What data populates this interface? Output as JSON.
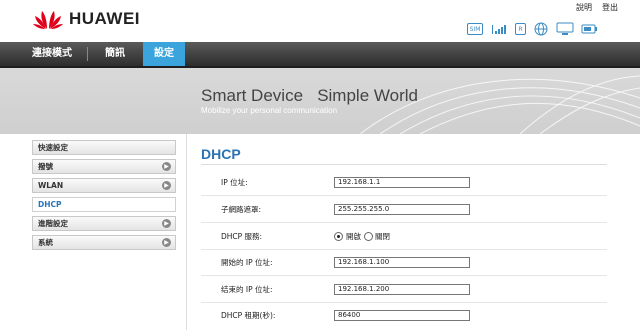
{
  "brand": {
    "name": "HUAWEI",
    "logo_icon": "huawei-petal-logo",
    "logo_color": "#e1001a"
  },
  "top_links": {
    "help": "說明",
    "logout": "登出"
  },
  "status_icons": [
    {
      "name": "sim-icon",
      "text": "SIM"
    },
    {
      "name": "signal-icon",
      "text": ""
    },
    {
      "name": "roaming-icon",
      "text": "R"
    },
    {
      "name": "globe-icon",
      "text": ""
    },
    {
      "name": "monitor-icon",
      "text": ""
    },
    {
      "name": "battery-icon",
      "text": ""
    }
  ],
  "nav": {
    "tabs": [
      {
        "label": "連接模式",
        "active": false
      },
      {
        "label": "簡訊",
        "active": false
      },
      {
        "label": "設定",
        "active": true
      }
    ],
    "active_color": "#3ba4dd"
  },
  "banner": {
    "title": "Smart Device   Simple World",
    "subtitle": "Mobilize your personal communication"
  },
  "sidebar": {
    "items": [
      {
        "label": "快速設定",
        "has_arrow": false,
        "active": false
      },
      {
        "label": "撥號",
        "has_arrow": true,
        "active": false
      },
      {
        "label": "WLAN",
        "has_arrow": true,
        "active": false
      },
      {
        "label": "DHCP",
        "has_arrow": false,
        "active": true
      },
      {
        "label": "進階設定",
        "has_arrow": true,
        "active": false
      },
      {
        "label": "系統",
        "has_arrow": true,
        "active": false
      }
    ]
  },
  "content": {
    "title": "DHCP",
    "title_color": "#2b73b5",
    "fields": {
      "ip_label": "IP 位址:",
      "ip_value": "192.168.1.1",
      "mask_label": "子網路遮罩:",
      "mask_value": "255.255.255.0",
      "dhcp_label": "DHCP 服務:",
      "dhcp_on": "開啟",
      "dhcp_off": "關閉",
      "dhcp_selected": "開啟",
      "start_label": "開始的 IP 位址:",
      "start_value": "192.168.1.100",
      "end_label": "结束的 IP 位址:",
      "end_value": "192.168.1.200",
      "lease_label": "DHCP 租期(秒):",
      "lease_value": "86400"
    }
  }
}
